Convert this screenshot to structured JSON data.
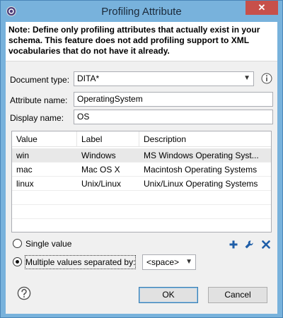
{
  "window": {
    "title": "Profiling Attribute",
    "close_glyph": "✕"
  },
  "note": "Note: Define only profiling attributes that actually exist in your schema. This feature does not add profiling support to XML vocabularies that do not have it already.",
  "form": {
    "document_type_label": "Document type:",
    "document_type_value": "DITA*",
    "attribute_name_label": "Attribute name:",
    "attribute_name_value": "OperatingSystem",
    "display_name_label": "Display name:",
    "display_name_value": "OS"
  },
  "table": {
    "columns": [
      "Value",
      "Label",
      "Description"
    ],
    "rows": [
      {
        "value": "win",
        "label": "Windows",
        "description": "MS Windows Operating Syst..."
      },
      {
        "value": "mac",
        "label": "Mac OS X",
        "description": "Macintosh Operating Systems"
      },
      {
        "value": "linux",
        "label": "Unix/Linux",
        "description": "Unix/Linux Operating Systems"
      }
    ]
  },
  "table_actions": [
    "add-icon",
    "edit-icon",
    "remove-icon"
  ],
  "options": {
    "single_value_label": "Single value",
    "multiple_values_label": "Multiple values separated by:",
    "separator_value": "<space>",
    "selected": "multiple"
  },
  "buttons": {
    "ok_label": "OK",
    "cancel_label": "Cancel"
  },
  "colors": {
    "titlebar": "#78b2dc",
    "close_button": "#c7504a",
    "action_icon": "#1f5ea8"
  }
}
